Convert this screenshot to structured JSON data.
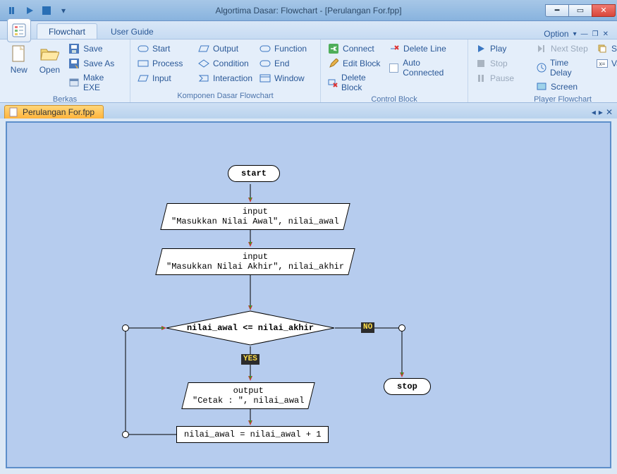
{
  "window": {
    "title": "Algortima Dasar: Flowchart - [Perulangan For.fpp]",
    "option_label": "Option",
    "tabs": {
      "flowchart": "Flowchart",
      "user_guide": "User Guide"
    },
    "doc_tab": "Perulangan For.fpp"
  },
  "ribbon": {
    "berkas": {
      "label": "Berkas",
      "new": "New",
      "open": "Open",
      "save": "Save",
      "save_as": "Save As",
      "make_exe": "Make EXE"
    },
    "komponen": {
      "label": "Komponen Dasar Flowchart",
      "start": "Start",
      "process": "Process",
      "input": "Input",
      "output": "Output",
      "condition": "Condition",
      "interaction": "Interaction",
      "function": "Function",
      "end": "End",
      "window": "Window"
    },
    "control": {
      "label": "Control Block",
      "connect": "Connect",
      "edit_block": "Edit Block",
      "delete_block": "Delete Block",
      "delete_line": "Delete Line",
      "auto_connected": "Auto Connected"
    },
    "player": {
      "label": "Player Flowchart",
      "play": "Play",
      "stop": "Stop",
      "pause": "Pause",
      "next_step": "Next Step",
      "time_delay": "Time Delay",
      "screen": "Screen",
      "stack": "Stack",
      "variable": "Variable"
    }
  },
  "chart_data": {
    "type": "flowchart",
    "nodes": [
      {
        "id": "start",
        "kind": "terminator",
        "text": "start"
      },
      {
        "id": "in1",
        "kind": "input",
        "text": "input\n\"Masukkan Nilai Awal\", nilai_awal"
      },
      {
        "id": "in2",
        "kind": "input",
        "text": "input\n\"Masukkan Nilai Akhir\", nilai_akhir"
      },
      {
        "id": "dec",
        "kind": "decision",
        "text": "nilai_awal <= nilai_akhir"
      },
      {
        "id": "out",
        "kind": "output",
        "text": "output\n\"Cetak : \", nilai_awal"
      },
      {
        "id": "proc",
        "kind": "process",
        "text": "nilai_awal = nilai_awal + 1"
      },
      {
        "id": "stop",
        "kind": "terminator",
        "text": "stop"
      }
    ],
    "edges": [
      {
        "from": "start",
        "to": "in1"
      },
      {
        "from": "in1",
        "to": "in2"
      },
      {
        "from": "in2",
        "to": "dec"
      },
      {
        "from": "dec",
        "to": "out",
        "label": "YES"
      },
      {
        "from": "dec",
        "to": "stop",
        "label": "NO"
      },
      {
        "from": "out",
        "to": "proc"
      },
      {
        "from": "proc",
        "to": "dec",
        "note": "loop back"
      }
    ],
    "labels": {
      "yes": "YES",
      "no": "NO"
    }
  }
}
